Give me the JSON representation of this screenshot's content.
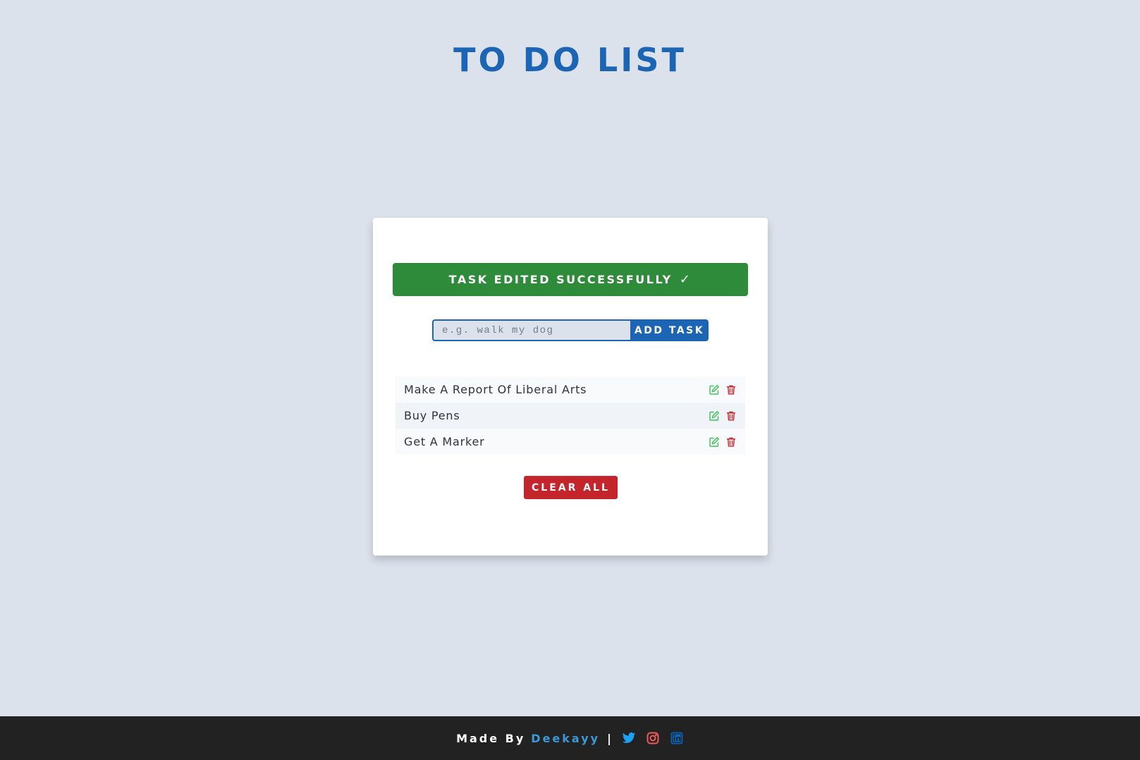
{
  "header": {
    "title": "TO DO LIST"
  },
  "alert": {
    "message": "TASK EDITED SUCCESSFULLY",
    "check": "✓",
    "color": "#2e8b3a"
  },
  "form": {
    "placeholder": "e.g. walk my dog",
    "value": "",
    "add_label": "ADD TASK"
  },
  "tasks": [
    {
      "text": "Make A Report Of Liberal Arts",
      "edit_icon": "edit-icon",
      "delete_icon": "trash-icon"
    },
    {
      "text": "Buy Pens",
      "edit_icon": "edit-icon",
      "delete_icon": "trash-icon"
    },
    {
      "text": "Get A Marker",
      "edit_icon": "edit-icon",
      "delete_icon": "trash-icon"
    }
  ],
  "clear_label": "CLEAR ALL",
  "footer": {
    "made_by": "Made By",
    "author": "Deekayy",
    "separator": "|",
    "social": [
      "twitter-icon",
      "instagram-icon",
      "linkedin-icon"
    ]
  },
  "colors": {
    "background": "#dbe2ec",
    "primary": "#1c65b5",
    "success": "#2e8b3a",
    "danger": "#c4242b",
    "edit_icon": "#3fbf5a",
    "delete_icon": "#c4242b",
    "footer_bg": "#222222",
    "author": "#3a9ad9"
  }
}
